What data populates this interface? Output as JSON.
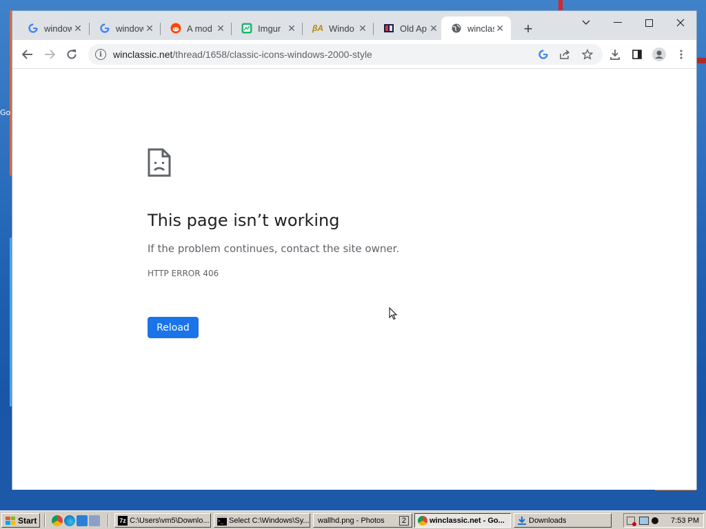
{
  "desktop": {
    "side_label": "Go"
  },
  "browser": {
    "tabs": [
      {
        "title": "window",
        "favicon": "google-g-icon",
        "active": false
      },
      {
        "title": "window",
        "favicon": "google-g-icon",
        "active": false
      },
      {
        "title": "A mod",
        "favicon": "reddit-icon",
        "active": false
      },
      {
        "title": "Imgur",
        "favicon": "imgur-icon",
        "active": false
      },
      {
        "title": "Windo",
        "favicon": "betaarchive-icon",
        "active": false
      },
      {
        "title": "Old Ap",
        "favicon": "oldapps-icon",
        "active": false
      },
      {
        "title": "winclas",
        "favicon": "globe-icon",
        "active": true
      }
    ],
    "url": {
      "host": "winclassic.net",
      "path": "/thread/1658/classic-icons-windows-2000-style"
    }
  },
  "error_page": {
    "title": "This page isn’t working",
    "description": "If the problem continues, contact the site owner.",
    "code": "HTTP ERROR 406",
    "reload_label": "Reload",
    "accent_color": "#1a73e8"
  },
  "taskbar": {
    "start_label": "Start",
    "buttons": [
      {
        "label": "C:\\Users\\vm5\\Downlo...",
        "icon": "7zip-icon",
        "active": false
      },
      {
        "label": "Select C:\\Windows\\Sy...",
        "icon": "cmd-icon",
        "active": false
      },
      {
        "label": "wallhd.png - Photos",
        "badge": "2",
        "icon": "photos-icon",
        "active": false
      },
      {
        "label": "winclassic.net - Go...",
        "icon": "chrome-icon",
        "active": true
      },
      {
        "label": "Downloads",
        "icon": "download-folder-icon",
        "active": false
      }
    ],
    "clock": "7:53 PM"
  }
}
